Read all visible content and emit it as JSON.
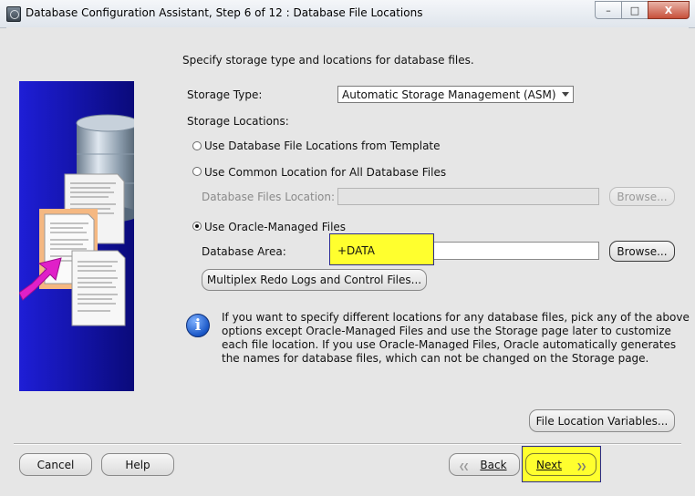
{
  "window": {
    "title": "Database Configuration Assistant, Step 6 of 12 : Database File Locations",
    "minimize_glyph": "–",
    "maximize_glyph": "□",
    "close_glyph": "X"
  },
  "intro": "Specify storage type and locations for database files.",
  "storage_type": {
    "label": "Storage Type:",
    "selected": "Automatic Storage Management (ASM)"
  },
  "storage_locations": {
    "label": "Storage Locations:",
    "options": [
      {
        "label": "Use Database File Locations from Template",
        "checked": false
      },
      {
        "label": "Use Common Location for All Database Files",
        "checked": false
      },
      {
        "label": "Use Oracle-Managed Files",
        "checked": true
      }
    ],
    "database_files_location": {
      "label": "Database Files Location:",
      "value": "",
      "browse_label": "Browse..."
    },
    "database_area": {
      "label": "Database Area:",
      "value": "+DATA",
      "browse_label": "Browse..."
    },
    "multiplex_label": "Multiplex Redo Logs and Control Files..."
  },
  "info": {
    "icon": "info-icon",
    "symbol": "i",
    "lines": [
      "If you want to specify different locations for any database files, pick any of the above",
      "options except Oracle-Managed Files and use the Storage page later to customize",
      "each file location. If you use Oracle-Managed Files, Oracle automatically generates",
      "the names for database files, which can not be changed on the Storage page."
    ]
  },
  "file_location_variables_label": "File Location Variables...",
  "footer": {
    "cancel": "Cancel",
    "help": "Help",
    "back": "Back",
    "next": "Next"
  },
  "colors": {
    "highlight": "#ffff2e",
    "sidebar_blue": "#1616b3",
    "arrow_magenta": "#e020c8"
  }
}
